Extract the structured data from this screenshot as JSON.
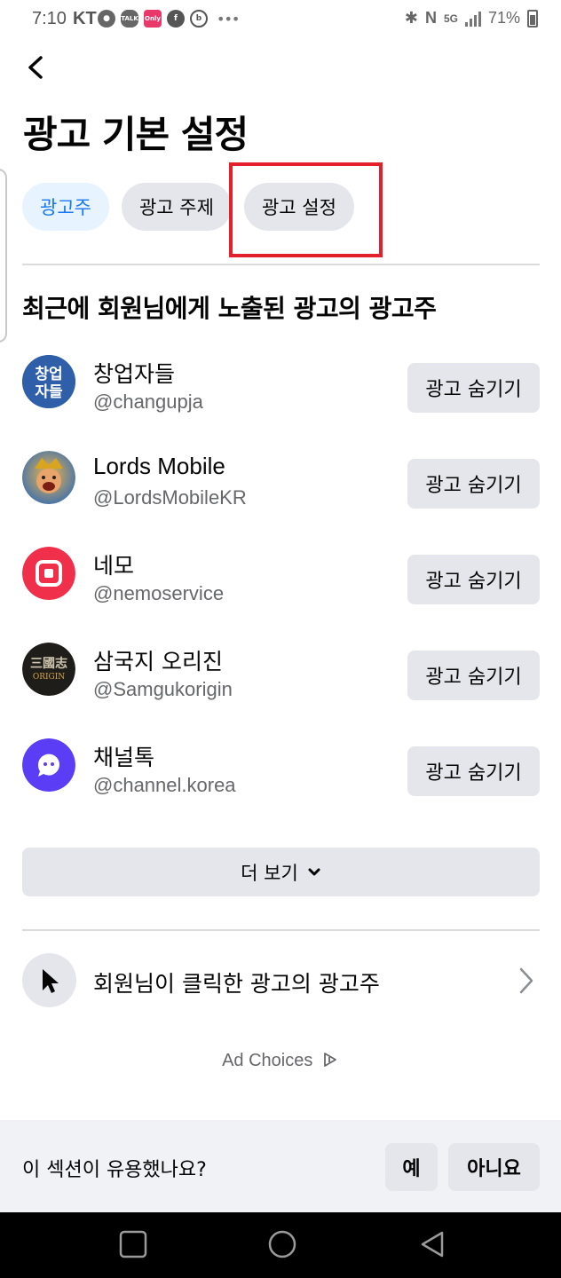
{
  "status_bar": {
    "time": "7:10",
    "carrier": "KT",
    "network": "5G",
    "battery": "71%"
  },
  "page": {
    "title": "광고 기본 설정"
  },
  "tabs": [
    {
      "label": "광고주",
      "active": true
    },
    {
      "label": "광고 주제",
      "active": false
    },
    {
      "label": "광고 설정",
      "active": false
    }
  ],
  "section": {
    "title": "최근에 회원님에게 노출된 광고의 광고주"
  },
  "advertisers": [
    {
      "name": "창업자들",
      "handle": "@changupja",
      "button": "광고 숨기기",
      "icon": "changupja-logo-icon"
    },
    {
      "name": "Lords Mobile",
      "handle": "@LordsMobileKR",
      "button": "광고 숨기기",
      "icon": "lords-mobile-logo-icon"
    },
    {
      "name": "네모",
      "handle": "@nemoservice",
      "button": "광고 숨기기",
      "icon": "nemo-logo-icon"
    },
    {
      "name": "삼국지 오리진",
      "handle": "@Samgukorigin",
      "button": "광고 숨기기",
      "icon": "samguk-origin-logo-icon"
    },
    {
      "name": "채널톡",
      "handle": "@channel.korea",
      "button": "광고 숨기기",
      "icon": "channel-talk-logo-icon"
    }
  ],
  "more": {
    "label": "더 보기"
  },
  "clicked_ads": {
    "label": "회원님이 클릭한 광고의 광고주"
  },
  "ad_choices": {
    "label": "Ad Choices"
  },
  "feedback": {
    "question": "이 섹션이 유용했나요?",
    "yes": "예",
    "no": "아니요"
  },
  "colors": {
    "accent": "#1877f2",
    "active_tab_bg": "#e7f3ff",
    "button_bg": "#e4e6eb",
    "highlight": "#e4202a"
  }
}
